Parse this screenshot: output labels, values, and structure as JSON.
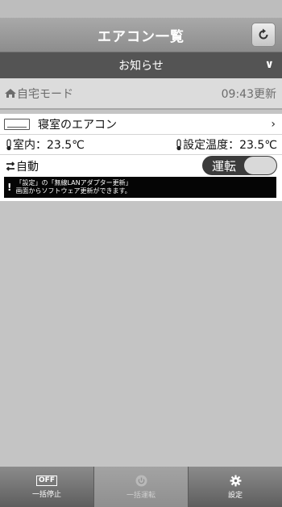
{
  "navbar": {
    "title": "エアコン一覧"
  },
  "notice": {
    "label": "お知らせ"
  },
  "mode_bar": {
    "label": "自宅モード",
    "updated": "09:43更新"
  },
  "aircon": {
    "name": "寝室のエアコン",
    "room_temp": "室内：23.5℃",
    "set_temp": "設定温度：23.5℃",
    "mode": "自動",
    "power_label": "運転"
  },
  "message": {
    "line1": "「設定」の「無線LANアダプター更新」",
    "line2": "画面からソフトウェア更新ができます。"
  },
  "tabs": [
    {
      "label": "一括停止",
      "icon": "off-icon",
      "badge": "OFF"
    },
    {
      "label": "一括運転",
      "icon": "power-icon"
    },
    {
      "label": "設定",
      "icon": "gear-icon"
    }
  ],
  "colors": {
    "navbar": "#999999",
    "notice_bar": "#545454",
    "message_bg": "#050505"
  }
}
